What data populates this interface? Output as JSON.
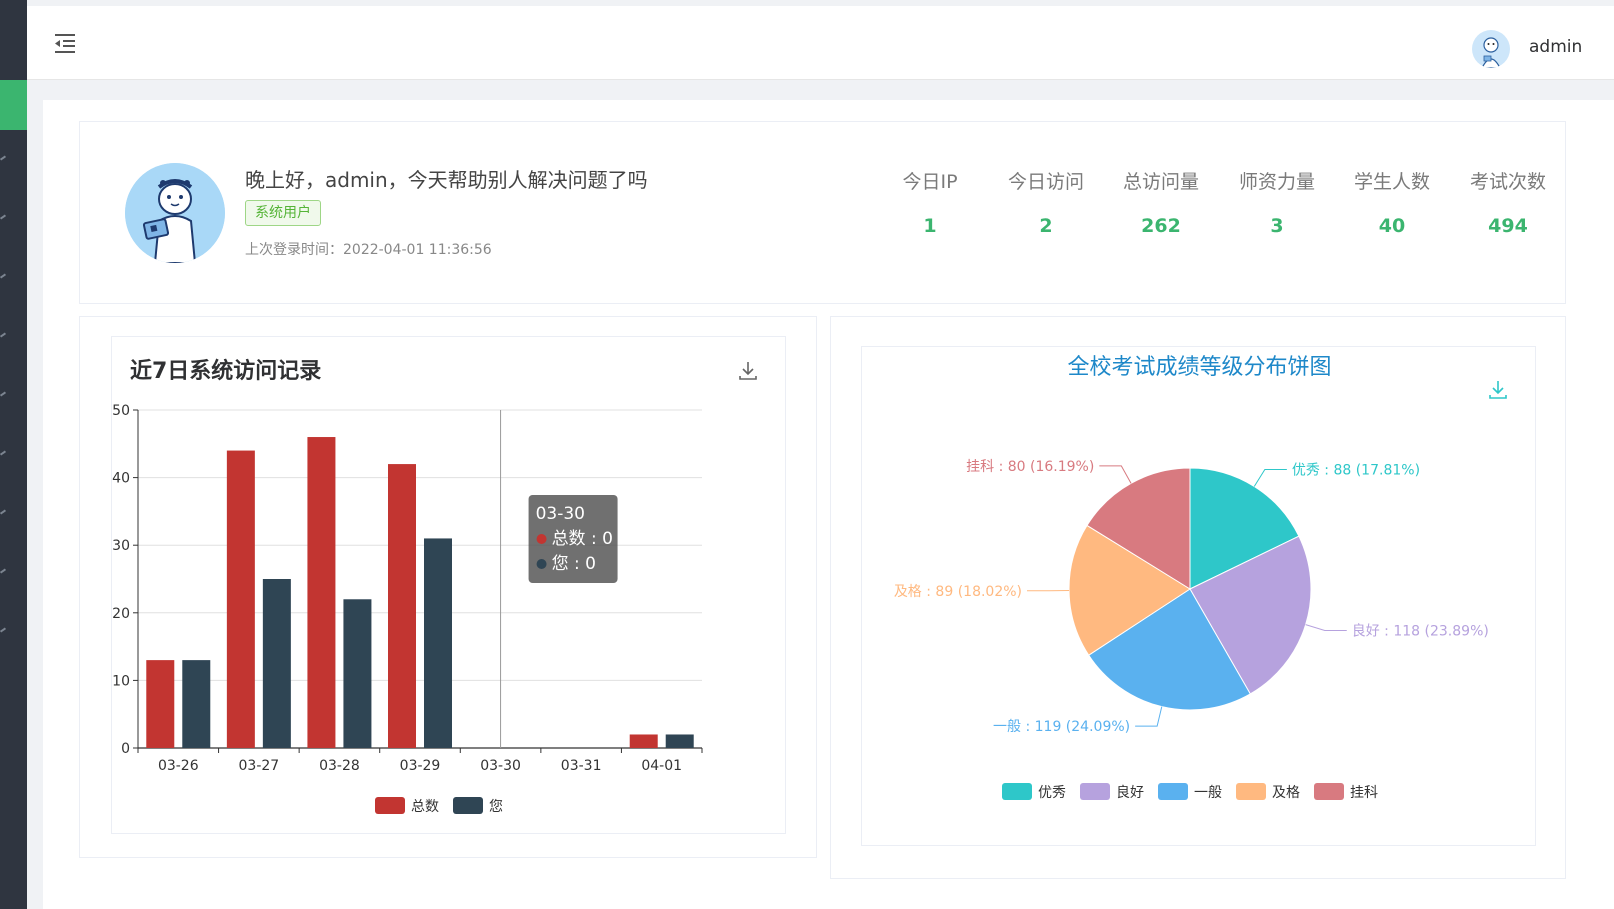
{
  "header": {
    "username": "admin"
  },
  "welcome": {
    "greeting": "晚上好，admin，今天帮助别人解决问题了吗",
    "role": "系统用户",
    "last_login_label": "上次登录时间：",
    "last_login_time": "2022-04-01 11:36:56"
  },
  "stats": [
    {
      "label": "今日IP",
      "value": "1"
    },
    {
      "label": "今日访问",
      "value": "2"
    },
    {
      "label": "总访问量",
      "value": "262"
    },
    {
      "label": "师资力量",
      "value": "3"
    },
    {
      "label": "学生人数",
      "value": "40"
    },
    {
      "label": "考试次数",
      "value": "494"
    }
  ],
  "bar_panel": {
    "title": "近7日系统访问记录"
  },
  "pie_panel": {
    "title": "全校考试成绩等级分布饼图"
  },
  "chart_data": [
    {
      "type": "bar",
      "title": "近7日系统访问记录",
      "categories": [
        "03-26",
        "03-27",
        "03-28",
        "03-29",
        "03-30",
        "03-31",
        "04-01"
      ],
      "series": [
        {
          "name": "总数",
          "values": [
            13,
            44,
            46,
            42,
            0,
            0,
            2
          ],
          "color": "#c23531"
        },
        {
          "name": "您",
          "values": [
            13,
            25,
            22,
            31,
            0,
            0,
            2
          ],
          "color": "#2f4554"
        }
      ],
      "ylim": [
        0,
        50
      ],
      "yticks": [
        0,
        10,
        20,
        30,
        40,
        50
      ],
      "grid": true,
      "legend": "bottom-center",
      "tooltip": {
        "category": "03-30",
        "lines": [
          {
            "label": "总数",
            "value": "0",
            "color": "#c23531"
          },
          {
            "label": "您",
            "value": "0",
            "color": "#2f4554"
          }
        ]
      }
    },
    {
      "type": "pie",
      "title": "全校考试成绩等级分布饼图",
      "slices": [
        {
          "name": "优秀",
          "value": 88,
          "percent": "17.81%",
          "color": "#2ec7c9"
        },
        {
          "name": "良好",
          "value": 118,
          "percent": "23.89%",
          "color": "#b6a2de"
        },
        {
          "name": "一般",
          "value": 119,
          "percent": "24.09%",
          "color": "#5ab1ef"
        },
        {
          "name": "及格",
          "value": 89,
          "percent": "18.02%",
          "color": "#ffb980"
        },
        {
          "name": "挂科",
          "value": 80,
          "percent": "16.19%",
          "color": "#d87a80"
        }
      ],
      "legend": "bottom-center"
    }
  ]
}
